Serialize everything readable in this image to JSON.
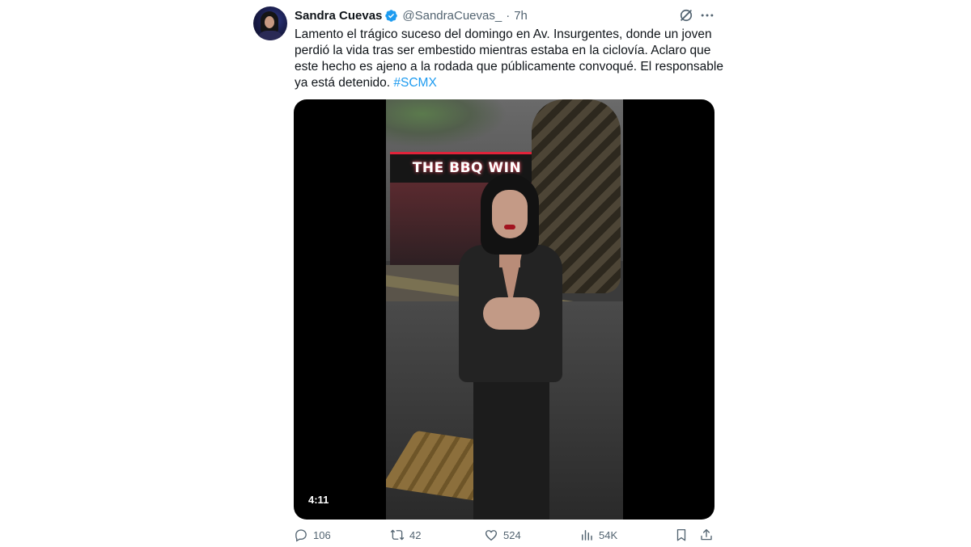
{
  "author": {
    "display_name": "Sandra Cuevas",
    "handle": "@SandraCuevas_",
    "separator": "·",
    "time": "7h"
  },
  "tweet": {
    "text": "Lamento el trágico suceso del domingo en Av. Insurgentes, donde un joven perdió la vida tras ser embestido mientras estaba en la ciclovía. Aclaro que este hecho es ajeno a la rodada que públicamente convoqué. El responsable ya está detenido.",
    "hashtag": "#SCMX"
  },
  "media": {
    "duration": "4:11",
    "sign_text": "THE BBQ WIN"
  },
  "actions": {
    "replies": "106",
    "reposts": "42",
    "likes": "524",
    "views": "54K"
  },
  "colors": {
    "accent": "#1d9bf0",
    "text_primary": "#0f1419",
    "text_secondary": "#536471"
  },
  "icons": [
    "verified-badge-icon",
    "grok-icon",
    "more-icon",
    "reply-icon",
    "repost-icon",
    "like-icon",
    "views-icon",
    "bookmark-icon",
    "share-icon"
  ]
}
